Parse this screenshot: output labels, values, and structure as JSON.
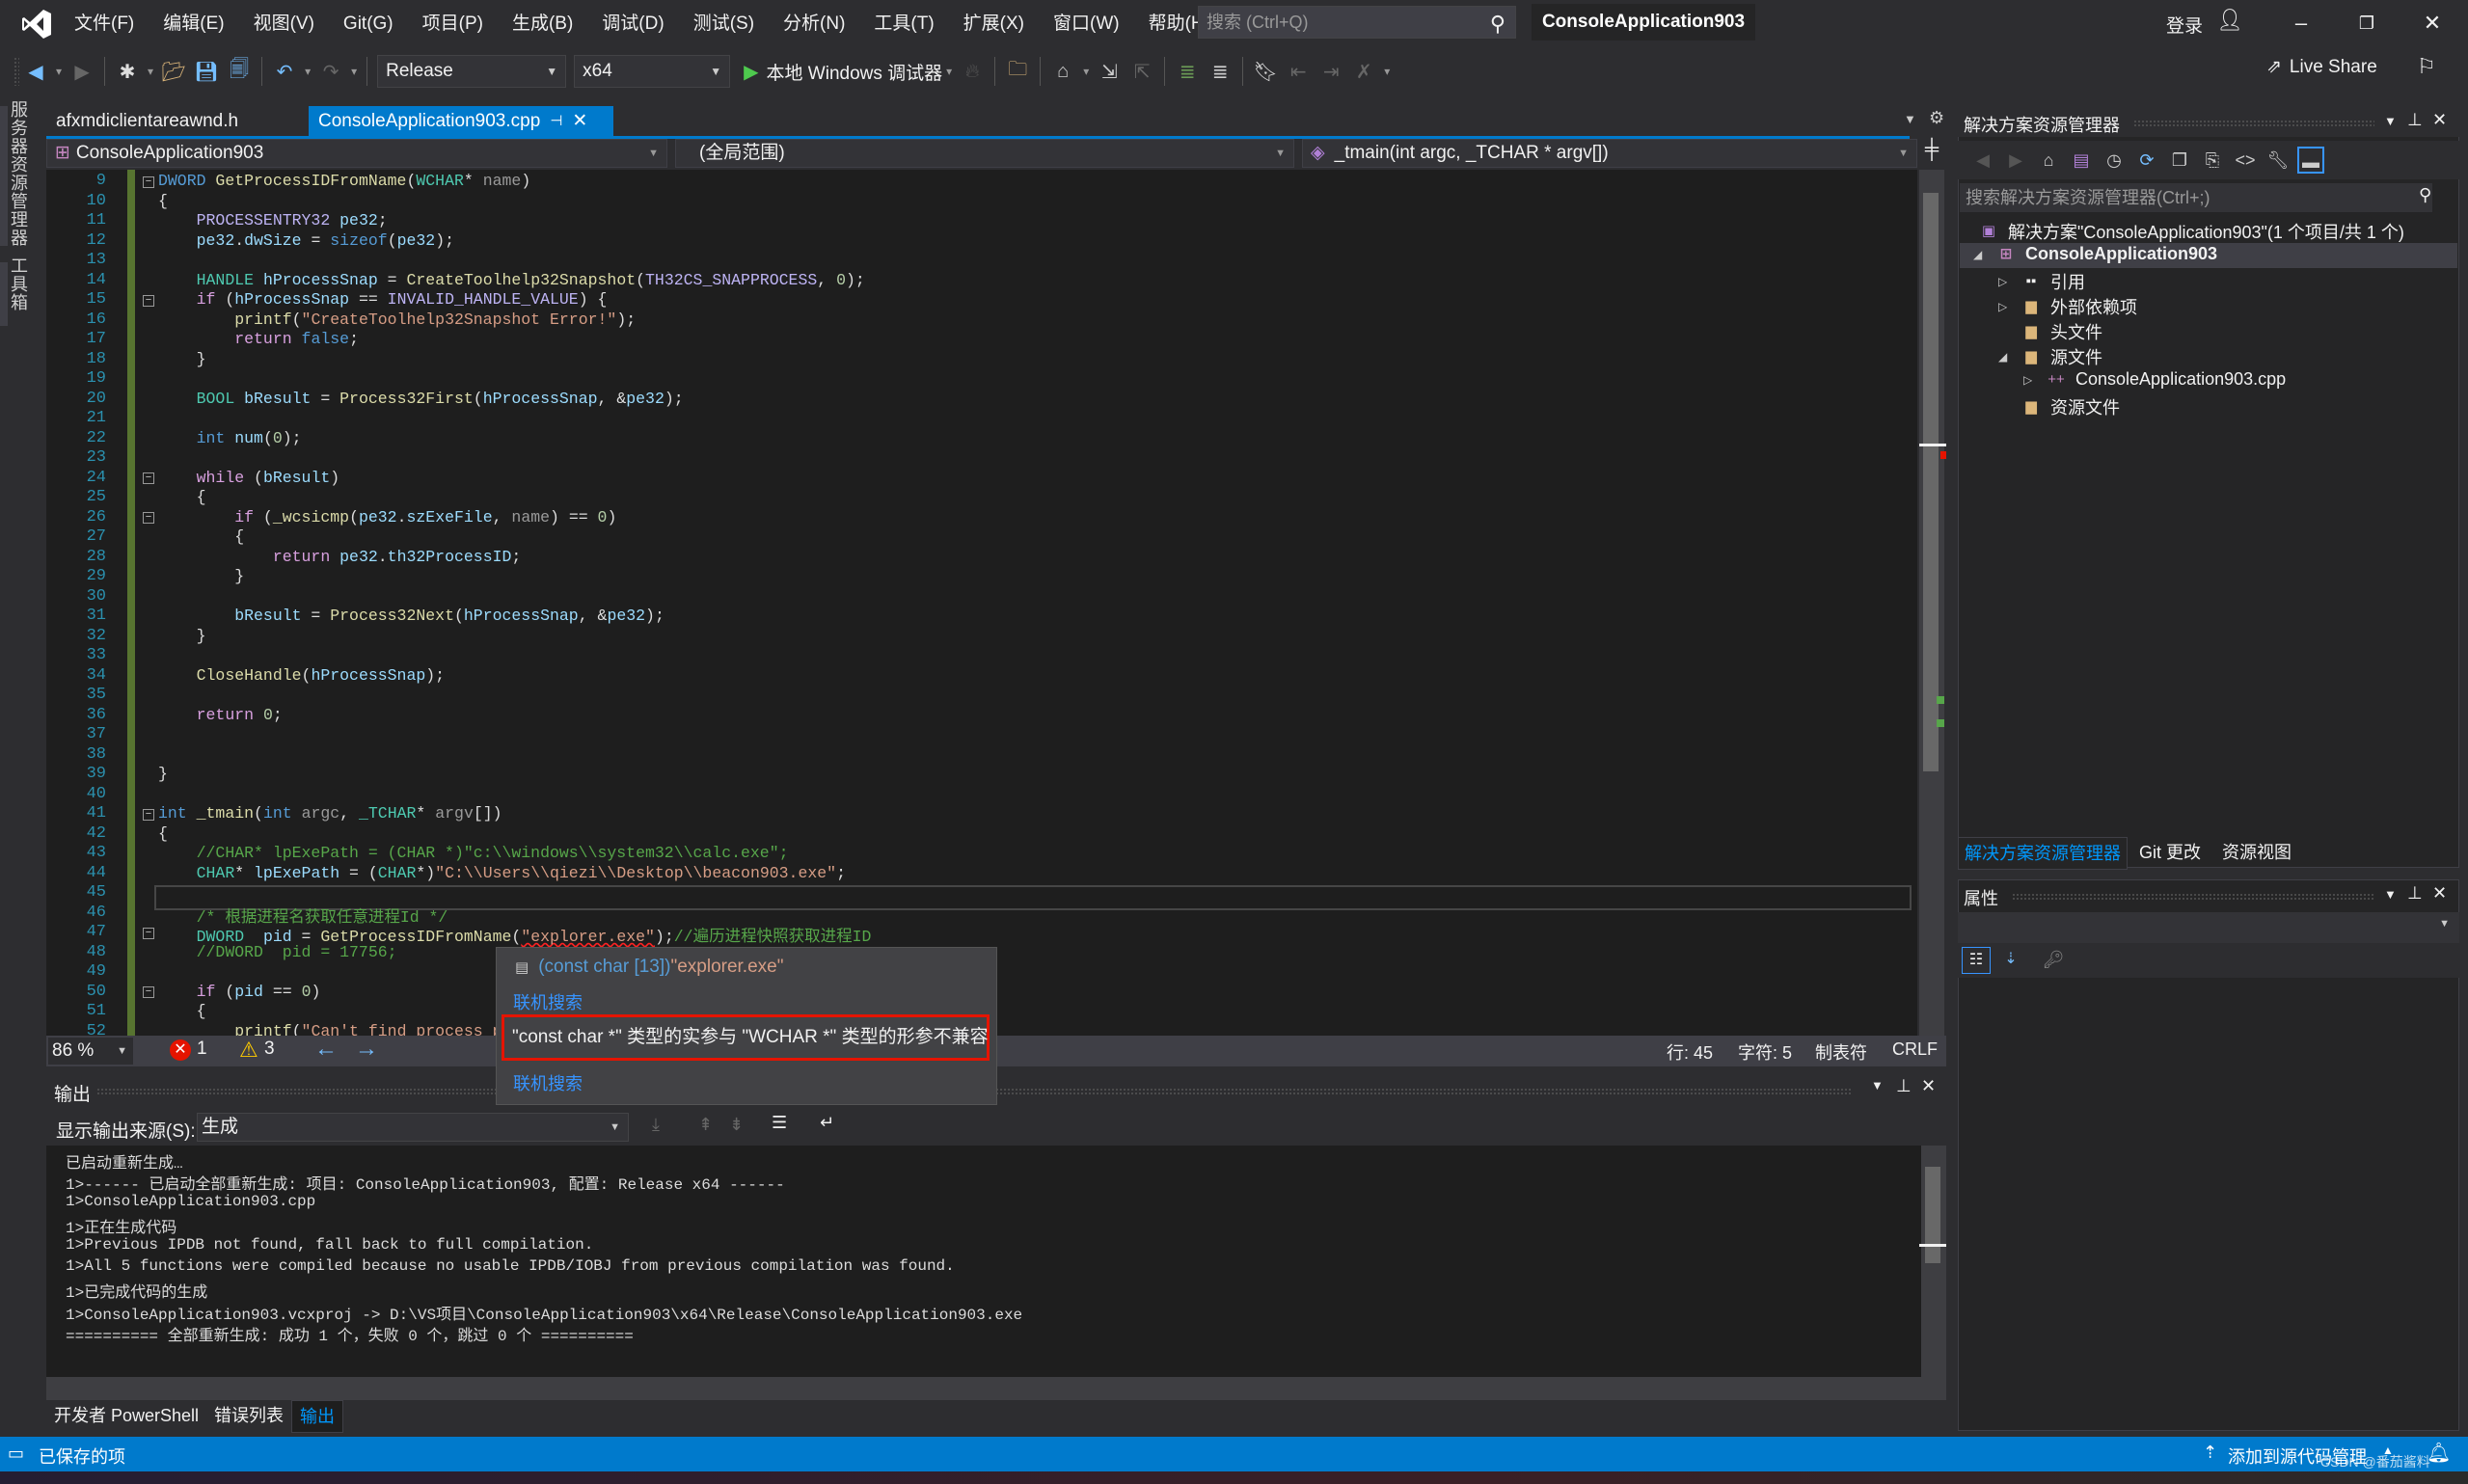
{
  "menubar": {
    "items": [
      "文件(F)",
      "编辑(E)",
      "视图(V)",
      "Git(G)",
      "项目(P)",
      "生成(B)",
      "调试(D)",
      "测试(S)",
      "分析(N)",
      "工具(T)",
      "扩展(X)",
      "窗口(W)",
      "帮助(H)"
    ],
    "search_placeholder": "搜索 (Ctrl+Q)",
    "window_title": "ConsoleApplication903",
    "login": "登录"
  },
  "toolbar": {
    "configuration": "Release",
    "platform": "x64",
    "run_label": "本地 Windows 调试器",
    "live_share": "Live Share"
  },
  "side_tabs": [
    "服务器资源管理器",
    "工具箱"
  ],
  "doc_tabs": [
    {
      "label": "afxmdiclientareawnd.h",
      "active": false
    },
    {
      "label": "ConsoleApplication903.cpp",
      "active": true
    }
  ],
  "navbar": {
    "project": "ConsoleApplication903",
    "scope": "(全局范围)",
    "member": "_tmain(int argc, _TCHAR * argv[])"
  },
  "editor": {
    "line_numbers": [
      "9",
      "10",
      "11",
      "12",
      "13",
      "14",
      "15",
      "16",
      "17",
      "18",
      "19",
      "20",
      "21",
      "22",
      "23",
      "24",
      "25",
      "26",
      "27",
      "28",
      "29",
      "30",
      "31",
      "32",
      "33",
      "34",
      "35",
      "36",
      "37",
      "38",
      "39",
      "40",
      "41",
      "42",
      "43",
      "44",
      "45",
      "46",
      "47",
      "48",
      "49",
      "50",
      "51",
      "52"
    ],
    "zoom": "86 %",
    "errors": "1",
    "warnings": "3",
    "row": "行: 45",
    "col": "字符: 5",
    "tabs": "制表符",
    "eol": "CRLF"
  },
  "tooltip": {
    "signature_type": "(const char [13])",
    "signature_value": "\"explorer.exe\"",
    "link1": "联机搜索",
    "error": "\"const char *\" 类型的实参与 \"WCHAR *\" 类型的形参不兼容",
    "link2": "联机搜索"
  },
  "output": {
    "title": "输出",
    "source_label": "显示输出来源(S):",
    "source_value": "生成",
    "lines": [
      "已启动重新生成…",
      "1>------ 已启动全部重新生成: 项目: ConsoleApplication903, 配置: Release x64 ------",
      "1>ConsoleApplication903.cpp",
      "1>正在生成代码",
      "1>Previous IPDB not found, fall back to full compilation.",
      "1>All 5 functions were compiled because no usable IPDB/IOBJ from previous compilation was found.",
      "1>已完成代码的生成",
      "1>ConsoleApplication903.vcxproj -> D:\\VS项目\\ConsoleApplication903\\x64\\Release\\ConsoleApplication903.exe",
      "========== 全部重新生成: 成功 1 个，失败 0 个，跳过 0 个 =========="
    ]
  },
  "bottom_tabs": [
    {
      "label": "开发者 PowerShell",
      "active": false
    },
    {
      "label": "错误列表",
      "active": false
    },
    {
      "label": "输出",
      "active": true
    }
  ],
  "solution_explorer": {
    "title": "解决方案资源管理器",
    "search_placeholder": "搜索解决方案资源管理器(Ctrl+;)",
    "tree": [
      {
        "label": "解决方案\"ConsoleApplication903\"(1 个项目/共 1 个)",
        "level": 0
      },
      {
        "label": "ConsoleApplication903",
        "level": 1,
        "bold": true
      },
      {
        "label": "引用",
        "level": 2
      },
      {
        "label": "外部依赖项",
        "level": 2
      },
      {
        "label": "头文件",
        "level": 2
      },
      {
        "label": "源文件",
        "level": 2
      },
      {
        "label": "ConsoleApplication903.cpp",
        "level": 3
      },
      {
        "label": "资源文件",
        "level": 2
      }
    ],
    "tabs": [
      "解决方案资源管理器",
      "Git 更改",
      "资源视图"
    ]
  },
  "properties": {
    "title": "属性"
  },
  "statusbar": {
    "left": "已保存的项",
    "right": "添加到源代码管理",
    "watermark": "CSDN @番茄酱料"
  },
  "colors": {
    "accent": "#007acc",
    "error": "#e51400",
    "warning": "#ffcc00",
    "link": "#3794ff"
  }
}
